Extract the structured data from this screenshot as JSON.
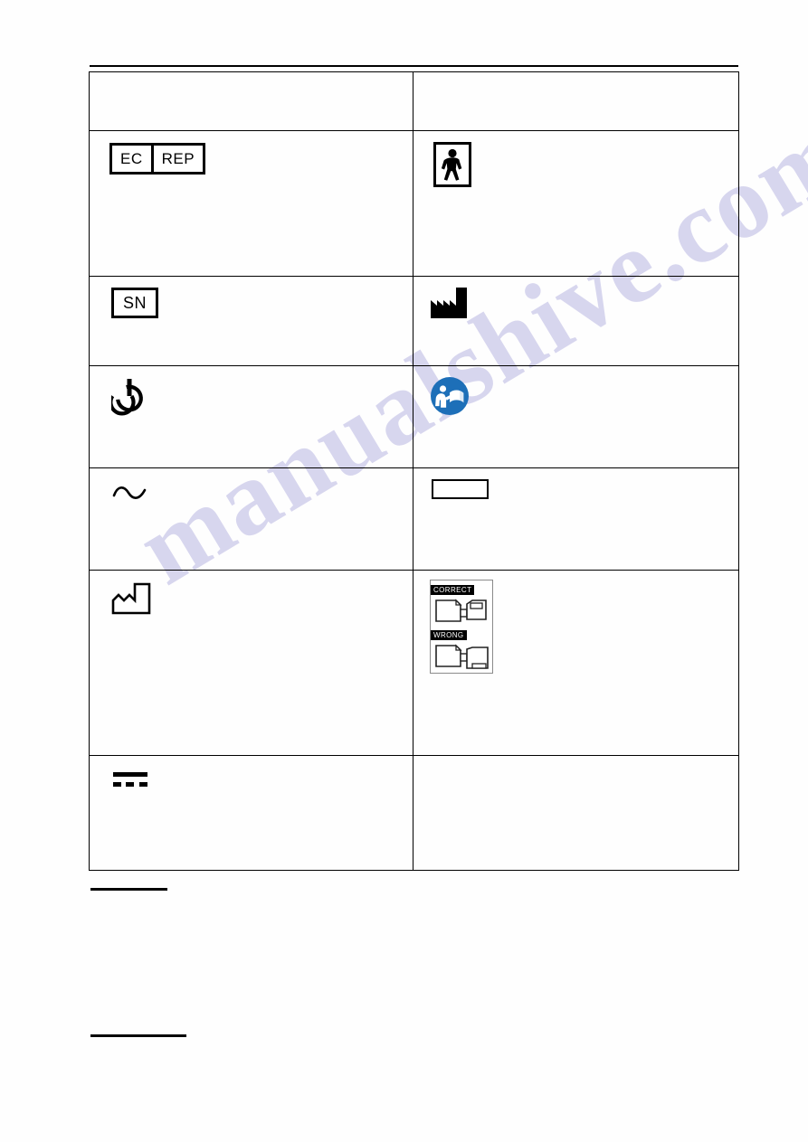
{
  "document": {
    "page_background": "#ffffff",
    "ink_color": "#000000",
    "watermark": {
      "text": "manualshive.com",
      "color": "#b9b6e2"
    }
  },
  "table": {
    "header": {
      "symbol_column": "",
      "description_column": ""
    },
    "rows": [
      {
        "left": {
          "icon": "ec-rep-authorized-representative-icon",
          "label_ec": "EC",
          "label_rep": "REP",
          "description": ""
        },
        "right": {
          "icon": "type-b-applied-part-icon",
          "description": ""
        }
      },
      {
        "left": {
          "icon": "serial-number-icon",
          "label_sn": "SN",
          "description": ""
        },
        "right": {
          "icon": "manufacturer-factory-icon",
          "description": ""
        }
      },
      {
        "left": {
          "icon": "standby-power-icon",
          "description": ""
        },
        "right": {
          "icon": "consult-instructions-for-use-icon",
          "description": ""
        }
      },
      {
        "left": {
          "icon": "alternating-current-icon",
          "description": ""
        },
        "right": {
          "icon": "blank-label-box-icon",
          "description": ""
        }
      },
      {
        "left": {
          "icon": "date-of-manufacture-icon",
          "description": ""
        },
        "right": {
          "icon": "correct-wrong-stacking-diagram-icon",
          "label_correct": "CORRECT",
          "label_wrong": "WRONG",
          "description": ""
        }
      },
      {
        "left": {
          "icon": "direct-current-icon",
          "description": ""
        },
        "right": {
          "icon": "",
          "description": ""
        }
      }
    ]
  },
  "body": {
    "heading_one": "",
    "paragraph_one": "",
    "heading_two": "",
    "paragraph_two": ""
  }
}
